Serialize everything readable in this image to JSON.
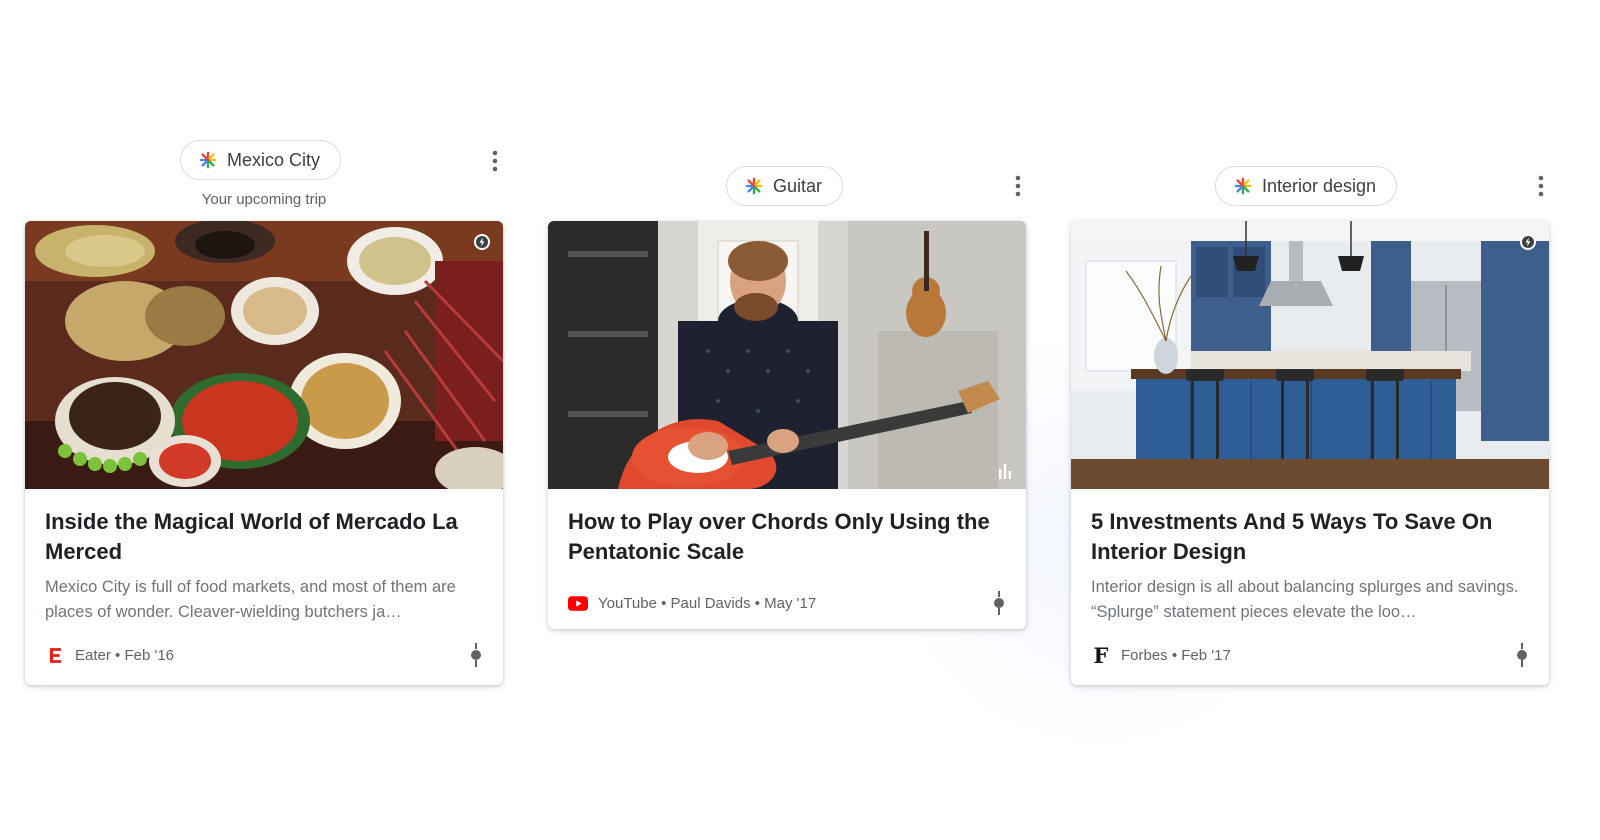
{
  "topics": [
    {
      "chip_label": "Mexico City",
      "subtitle": "Your upcoming trip",
      "icon": "discover-spark-icon",
      "card": {
        "title": "Inside the Magical World of Mercado La Merced",
        "snippet": "Mexico City is full of food markets, and most of them are places of wonder. Cleaver-wielding butchers ja…",
        "source": "Eater",
        "date": "Feb '16",
        "meta_text": "Eater • Feb '16",
        "source_logo": "E",
        "badge": "amp-lightning-icon"
      }
    },
    {
      "chip_label": "Guitar",
      "icon": "discover-spark-icon",
      "card": {
        "title": "How to Play over Chords Only Using the Pentatonic Scale",
        "source": "YouTube",
        "author": "Paul Davids",
        "date": "May '17",
        "meta_text": "YouTube • Paul Davids • May '17",
        "badge": "video-bars-icon"
      }
    },
    {
      "chip_label": "Interior design",
      "icon": "discover-spark-icon",
      "card": {
        "title": "5 Investments And 5 Ways To Save On Interior Design",
        "snippet": "Interior design is all about balancing splurges and savings. “Splurge” statement pieces elevate the loo…",
        "source": "Forbes",
        "date": "Feb '17",
        "meta_text": "Forbes • Feb '17",
        "source_logo": "F",
        "badge": "amp-lightning-icon"
      }
    }
  ],
  "colors": {
    "eater_red": "#e2231a",
    "youtube_red": "#ff0000",
    "text_primary": "#202124",
    "text_secondary": "#70757a"
  }
}
